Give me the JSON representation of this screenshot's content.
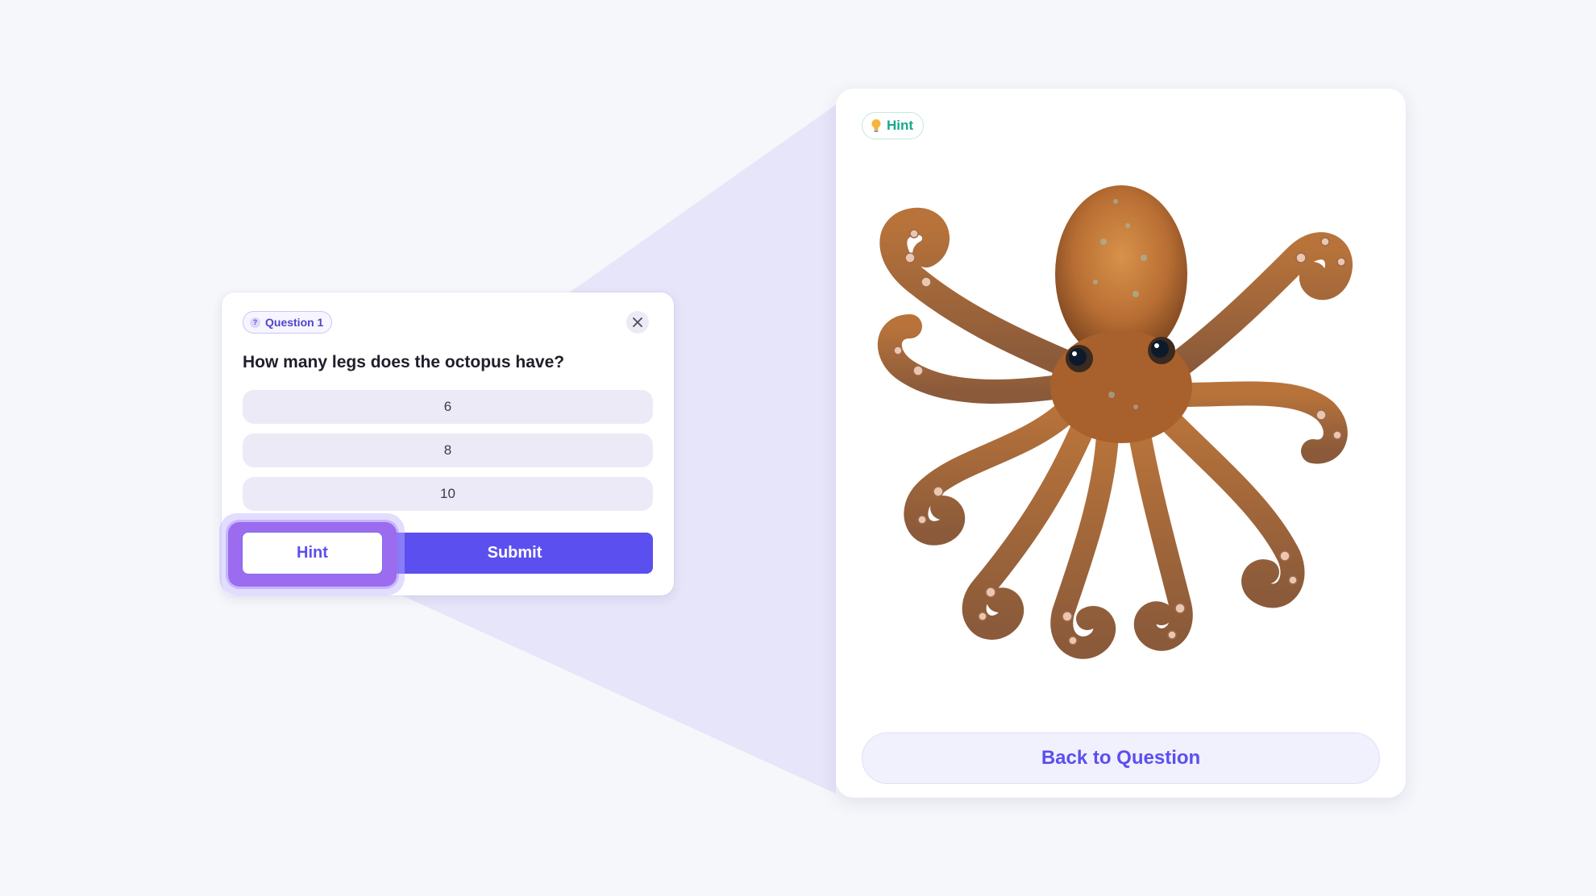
{
  "quiz": {
    "badge_label": "Question 1",
    "question_text": "How many legs does the octopus have?",
    "options": [
      "6",
      "8",
      "10"
    ],
    "hint_label": "Hint",
    "submit_label": "Submit"
  },
  "hint_panel": {
    "badge_label": "Hint",
    "back_label": "Back to Question"
  },
  "colors": {
    "accent": "#5b4ff0",
    "hint_green": "#16a98a",
    "highlight": "#9b6cf0",
    "background": "#f6f7fb"
  },
  "icons": {
    "question_badge": "question-icon",
    "close": "close-icon",
    "hint_badge": "lightbulb-icon"
  }
}
